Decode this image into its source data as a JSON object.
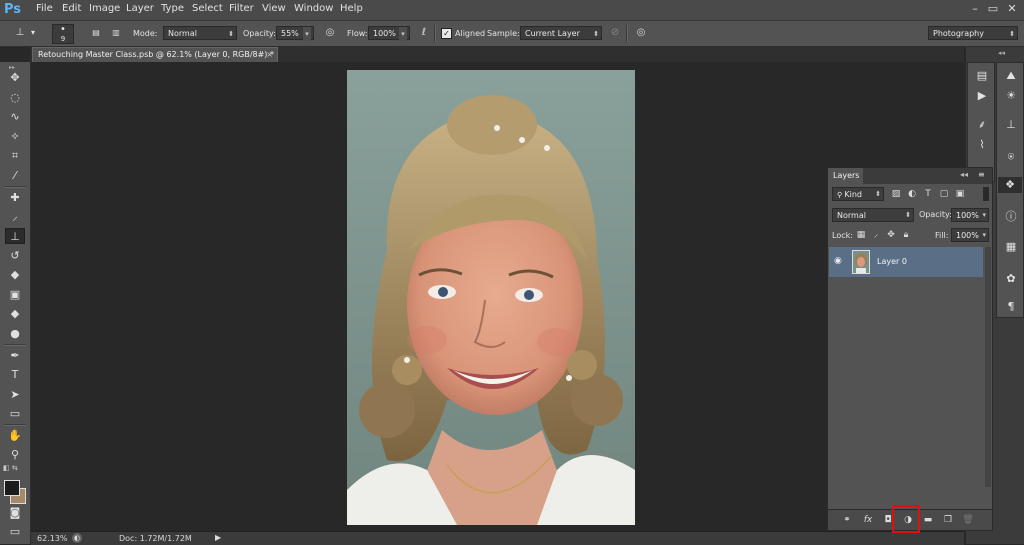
{
  "app": {
    "logo": "Ps"
  },
  "menu": [
    "File",
    "Edit",
    "Image",
    "Layer",
    "Type",
    "Select",
    "Filter",
    "View",
    "Window",
    "Help"
  ],
  "window_controls": {
    "minimize": "–",
    "maximize": "▭",
    "close": "✕"
  },
  "options_bar": {
    "brush_size": "9",
    "mode_label": "Mode:",
    "mode_value": "Normal",
    "opacity_label": "Opacity:",
    "opacity_value": "55%",
    "flow_label": "Flow:",
    "flow_value": "100%",
    "aligned_label": "Aligned",
    "aligned_checked": true,
    "sample_label": "Sample:",
    "sample_value": "Current Layer",
    "workspace_value": "Photography"
  },
  "document": {
    "tab_title": "Retouching Master Class.psb @ 62.1% (Layer 0, RGB/8#) *",
    "tab_close": "×"
  },
  "status": {
    "zoom": "62.13%",
    "doc_info": "Doc: 1.72M/1.72M"
  },
  "tools": [
    {
      "name": "move-tool-icon",
      "glyph": "✥"
    },
    {
      "name": "marquee-tool-icon",
      "glyph": "◌"
    },
    {
      "name": "lasso-tool-icon",
      "glyph": "ഠ"
    },
    {
      "name": "magic-wand-tool-icon",
      "glyph": "✧"
    },
    {
      "name": "crop-tool-icon",
      "glyph": "⌗"
    },
    {
      "name": "eyedropper-tool-icon",
      "glyph": "⁄"
    },
    {
      "name": "healing-brush-tool-icon",
      "glyph": "✚"
    },
    {
      "name": "brush-tool-icon",
      "glyph": "⸝"
    },
    {
      "name": "clone-stamp-tool-icon",
      "glyph": "⊥"
    },
    {
      "name": "history-brush-tool-icon",
      "glyph": "↺"
    },
    {
      "name": "eraser-tool-icon",
      "glyph": "◆"
    },
    {
      "name": "gradient-tool-icon",
      "glyph": "▣"
    },
    {
      "name": "blur-tool-icon",
      "glyph": "◆"
    },
    {
      "name": "dodge-tool-icon",
      "glyph": "●"
    },
    {
      "name": "pen-tool-icon",
      "glyph": "✒"
    },
    {
      "name": "type-tool-icon",
      "glyph": "T"
    },
    {
      "name": "path-selection-tool-icon",
      "glyph": "➤"
    },
    {
      "name": "shape-tool-icon",
      "glyph": "▭"
    },
    {
      "name": "hand-tool-icon",
      "glyph": "✋"
    },
    {
      "name": "zoom-tool-icon",
      "glyph": "⚲"
    }
  ],
  "colors": {
    "foreground": "#1b1b1b",
    "background": "#a58a6a",
    "selection_blue": "#5a6f86",
    "highlight_red": "#e01010",
    "ps_blue": "#5fb4f0"
  },
  "layers_panel": {
    "tab_label": "Layers",
    "filter_kind": "Kind",
    "blend_mode": "Normal",
    "opacity_label": "Opacity:",
    "opacity_value": "100%",
    "lock_label": "Lock:",
    "fill_label": "Fill:",
    "fill_value": "100%",
    "layers": [
      {
        "name": "Layer 0",
        "visible": true,
        "selected": true
      }
    ]
  },
  "right_dock": {
    "col1_icons": [
      "histogram-icon",
      "actions-play-icon",
      "brush-presets-icon",
      "paths-icon"
    ],
    "col2_icons": [
      "navigator-icon",
      "adjustments-icon",
      "clone-source-icon",
      "layers-icon",
      "info-icon",
      "properties-icon",
      "styles-icon",
      "paragraph-icon"
    ]
  }
}
